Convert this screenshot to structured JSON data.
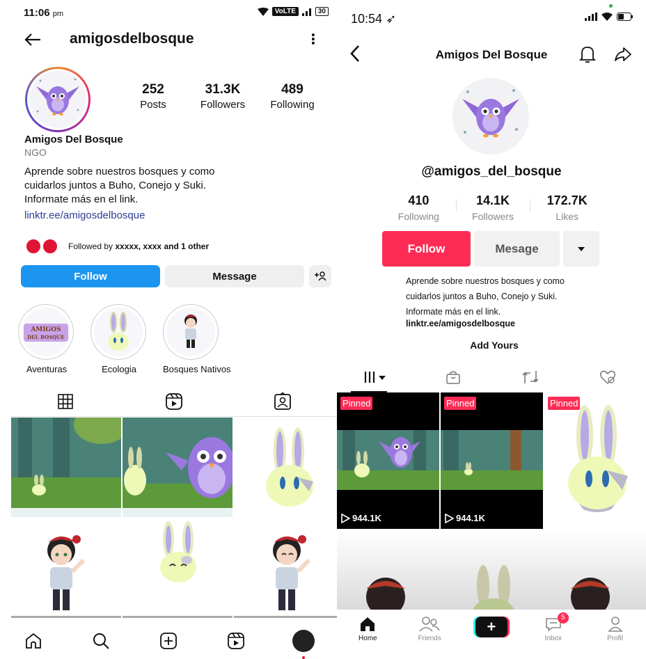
{
  "instagram": {
    "status": {
      "time": "11:06",
      "ampm": "pm",
      "net": "VoLTE",
      "battery": "30"
    },
    "username": "amigosdelbosque",
    "stats": [
      {
        "value": "252",
        "label": "Posts"
      },
      {
        "value": "31.3K",
        "label": "Followers"
      },
      {
        "value": "489",
        "label": "Following"
      }
    ],
    "name": "Amigos Del Bosque",
    "category": "NGO",
    "bio": [
      "Aprende sobre nuestros bosques y como",
      "cuidarlos juntos a Buho, Conejo y Suki.",
      "Informate más en el link."
    ],
    "link": "linktr.ee/amigosdelbosque",
    "followed_by": {
      "prefix": "Followed by ",
      "names": "xxxxx, xxxx and 1 other"
    },
    "buttons": {
      "follow": "Follow",
      "message": "Message"
    },
    "highlights": [
      {
        "label": "Aventuras",
        "art_text": "AMIGOS DEL BOSQUE"
      },
      {
        "label": "Ecologia"
      },
      {
        "label": "Bosques Nativos"
      }
    ],
    "tabs": [
      "grid-icon",
      "reels-icon",
      "tagged-icon"
    ],
    "nav": [
      "home-icon",
      "search-icon",
      "create-icon",
      "reels-icon",
      "profile-avatar"
    ],
    "colors": {
      "follow": "#1c95f0",
      "link": "#2b3d93"
    }
  },
  "tiktok": {
    "status": {
      "time": "10:54"
    },
    "title": "Amigos Del Bosque",
    "handle": "@amigos_del_bosque",
    "stats": [
      {
        "value": "410",
        "label": "Following"
      },
      {
        "value": "14.1K",
        "label": "Followers"
      },
      {
        "value": "172.7K",
        "label": "Likes"
      }
    ],
    "buttons": {
      "follow": "Follow",
      "message": "Mesage"
    },
    "bio": [
      "Aprende sobre nuestros bosques y como",
      "cuidarlos juntos a Buho, Conejo y Suki.",
      "Informate más en el link."
    ],
    "link": "linktr.ee/amigosdelbosque",
    "add_yours": "Add Yours",
    "videos": [
      {
        "pinned": "Pinned",
        "views": "944.1K"
      },
      {
        "pinned": "Pinned",
        "views": "944.1K"
      },
      {
        "pinned": "Pinned"
      }
    ],
    "nav": [
      {
        "label": "Home",
        "icon": "home-icon"
      },
      {
        "label": "Friends",
        "icon": "friends-icon"
      },
      {
        "label": "",
        "icon": "create-icon"
      },
      {
        "label": "Inbox",
        "icon": "inbox-icon",
        "badge": "5"
      },
      {
        "label": "Profil",
        "icon": "profile-icon"
      }
    ],
    "colors": {
      "accent": "#fe2c55"
    }
  }
}
